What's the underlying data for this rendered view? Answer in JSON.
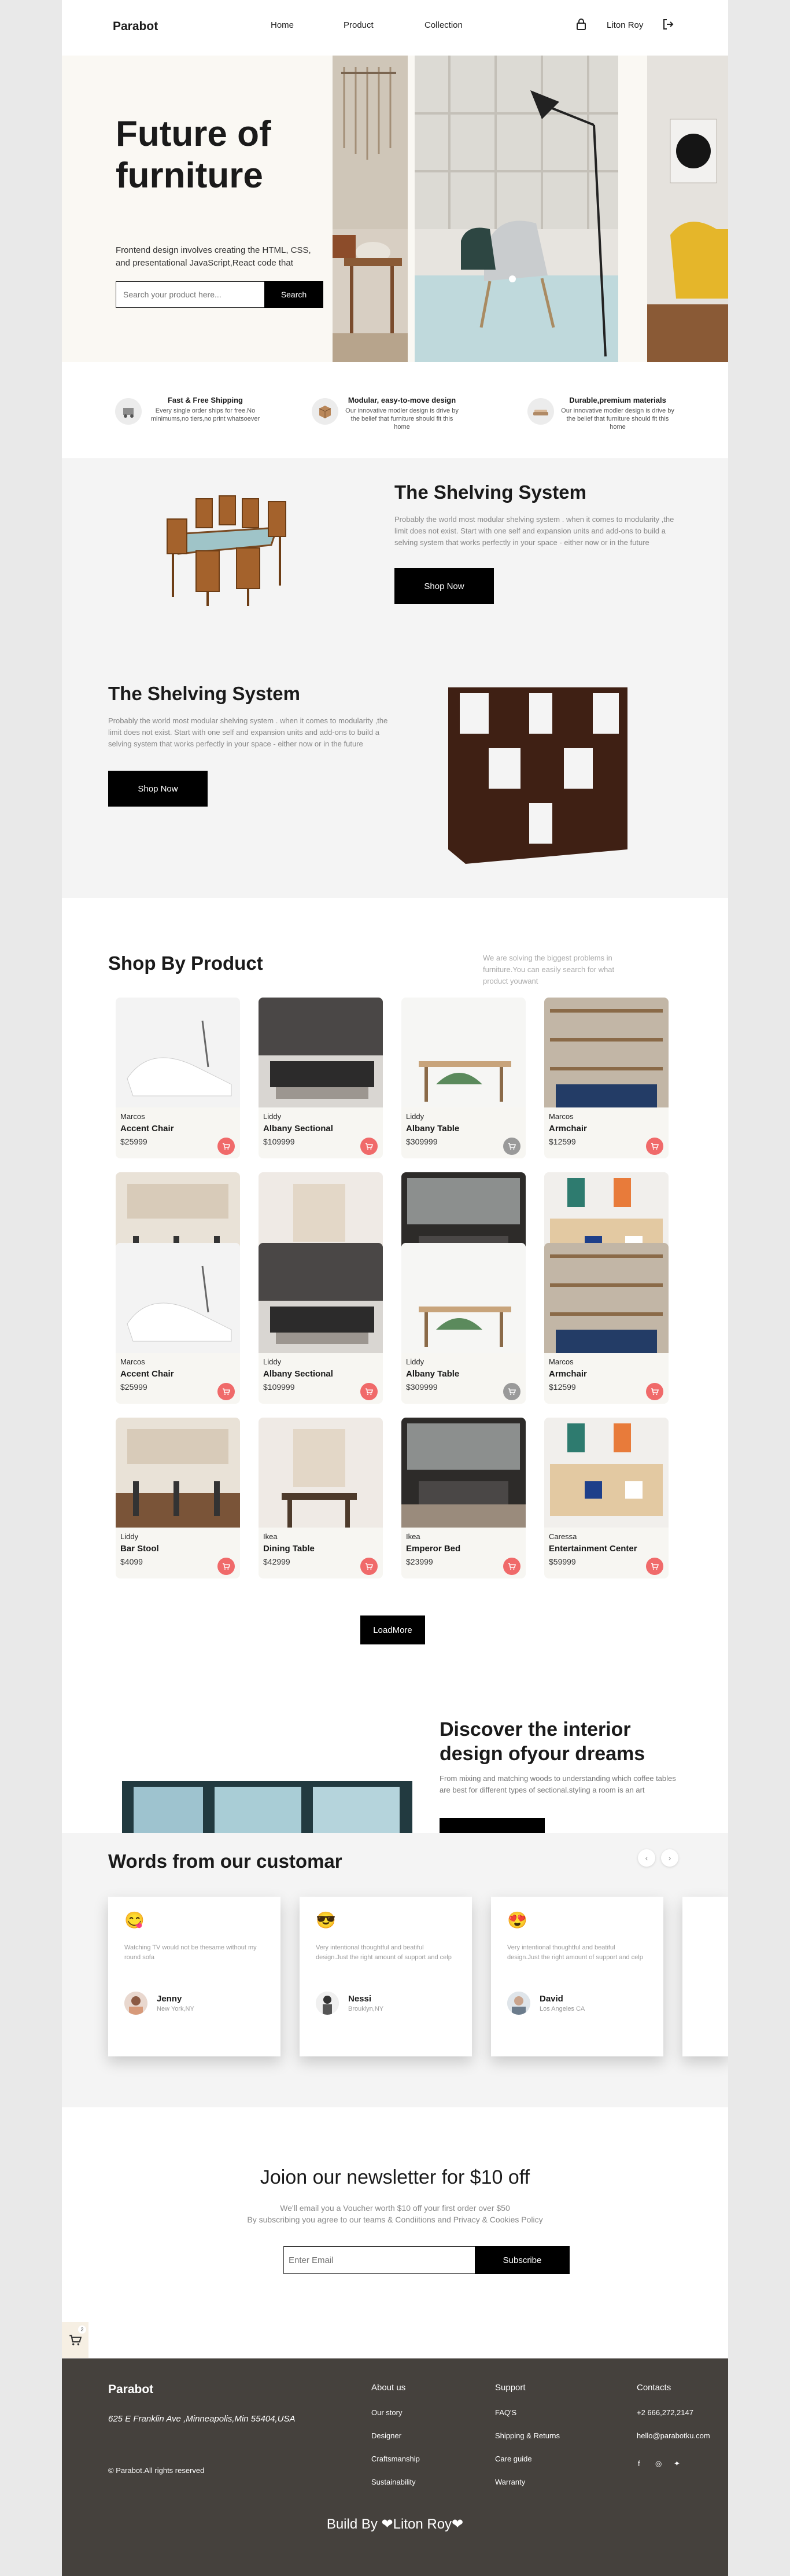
{
  "header": {
    "logo": "Parabot",
    "nav": [
      "Home",
      "Product",
      "Collection"
    ],
    "user_name": "Liton Roy"
  },
  "hero": {
    "title": "Future of furniture",
    "subtitle": "Frontend design involves creating the HTML, CSS, and presentational JavaScript,React code that",
    "search_placeholder": "Search your product here...",
    "search_button": "Search"
  },
  "features": [
    {
      "title": "Fast & Free Shipping",
      "text": "Every single order ships for free.No minimums,no tiers,no print whatsoever",
      "icon": "shipping-icon"
    },
    {
      "title": "Modular, easy-to-move design",
      "text": "Our innovative modler design is drive by the belief that furniture should fit this home",
      "icon": "box-icon"
    },
    {
      "title": "Durable,premium materials",
      "text": "Our innovative modler design is drive by the belief that furniture should fit this home",
      "icon": "sofa-icon"
    }
  ],
  "shelving": [
    {
      "title": "The Shelving System",
      "text": "Probably the world most modular shelving system . when it comes to modularity ,the limit does not exist. Start with one self and expansion units and add-ons to build a selving system that works perfectly in your space - either now or in the future",
      "button": "Shop Now"
    },
    {
      "title": "The Shelving System",
      "text": "Probably the world most modular shelving system . when it comes to modularity ,the limit does not exist. Start with one self and expansion units and add-ons to build a selving system that works perfectly in your space - either now or in the future",
      "button": "Shop Now"
    }
  ],
  "shop": {
    "title": "Shop By Product",
    "subtitle": "We are solving the biggest problems in furniture.You can easily search for what product youwant",
    "load_more": "LoadMore",
    "products": [
      {
        "brand": "Marcos",
        "name": "Accent Chair",
        "price": "$25999",
        "img": "chair"
      },
      {
        "brand": "Liddy",
        "name": "Albany Sectional",
        "price": "$109999",
        "img": "sofa"
      },
      {
        "brand": "Liddy",
        "name": "Albany Table",
        "price": "$309999",
        "img": "table"
      },
      {
        "brand": "Marcos",
        "name": "Armchair",
        "price": "$12599",
        "img": "shelf"
      },
      {
        "brand": "Liddy",
        "name": "Bar Stool",
        "price": "$4099",
        "img": "kitchen"
      },
      {
        "brand": "Ikea",
        "name": "Dining Table",
        "price": "$42999",
        "img": "dining"
      },
      {
        "brand": "Ikea",
        "name": "Emperor Bed",
        "price": "$23999",
        "img": "bed"
      },
      {
        "brand": "Caressa",
        "name": "Entertainment Center",
        "price": "$59999",
        "img": "cabinet"
      },
      {
        "brand": "Marcos",
        "name": "Accent Chair",
        "price": "$25999",
        "img": "chair"
      },
      {
        "brand": "Liddy",
        "name": "Albany Sectional",
        "price": "$109999",
        "img": "sofa"
      },
      {
        "brand": "Liddy",
        "name": "Albany Table",
        "price": "$309999",
        "img": "table"
      },
      {
        "brand": "Marcos",
        "name": "Armchair",
        "price": "$12599",
        "img": "shelf"
      },
      {
        "brand": "Liddy",
        "name": "Bar Stool",
        "price": "$4099",
        "img": "kitchen"
      },
      {
        "brand": "Ikea",
        "name": "Dining Table",
        "price": "$42999",
        "img": "dining"
      },
      {
        "brand": "Ikea",
        "name": "Emperor Bed",
        "price": "$23999",
        "img": "bed"
      },
      {
        "brand": "Caressa",
        "name": "Entertainment Center",
        "price": "$59999",
        "img": "cabinet"
      }
    ]
  },
  "discover": {
    "title": "Discover the interior design ofyour dreams",
    "text": "From mixing and matching woods to understanding which coffee tables are best for different types of sectional.styling a room is an art"
  },
  "testimonials": {
    "title": "Words from our customar",
    "items": [
      {
        "emoji": "😋",
        "text": "Watching TV would not be thesame without my round sofa",
        "name": "Jenny",
        "location": "New York,NY"
      },
      {
        "emoji": "😎",
        "text": "Very intentional thoughtful and beatiful design.Just the right amount of support and celp",
        "name": "Nessi",
        "location": "Brouklyn,NY"
      },
      {
        "emoji": "😍",
        "text": "Very intentional thoughtful and beatiful design.Just the right amount of support and celp",
        "name": "David",
        "location": "Los Angeles CA"
      }
    ]
  },
  "newsletter": {
    "title": "Joion our newsletter for $10 off",
    "line1": "We'll email you a Voucher worth $10 off your first order over $50",
    "line2": "By subscribing you agree to our teams & Condiitions and Privacy & Cookies Policy",
    "placeholder": "Enter Email",
    "button": "Subscribe"
  },
  "chat_badge": "2",
  "footer": {
    "brand": "Parabot",
    "address": "625 E Franklin Ave ,Minneapolis,Min 55404,USA",
    "copyright": "© Parabot.All rights reserved",
    "about": {
      "heading": "About us",
      "links": [
        "Our story",
        "Designer",
        "Craftsmanship",
        "Sustainability"
      ]
    },
    "support": {
      "heading": "Support",
      "links": [
        "FAQ'S",
        "Shipping & Returns",
        "Care guide",
        "Warranty"
      ]
    },
    "contacts": {
      "heading": "Contacts",
      "phone": "+2 666,272,2147",
      "email": "hello@parabotku.com"
    },
    "built_by": "Build By ❤Liton Roy❤"
  },
  "colors": {
    "accent": "#000000",
    "cart": "#f06a6a",
    "footer": "#45413d"
  }
}
